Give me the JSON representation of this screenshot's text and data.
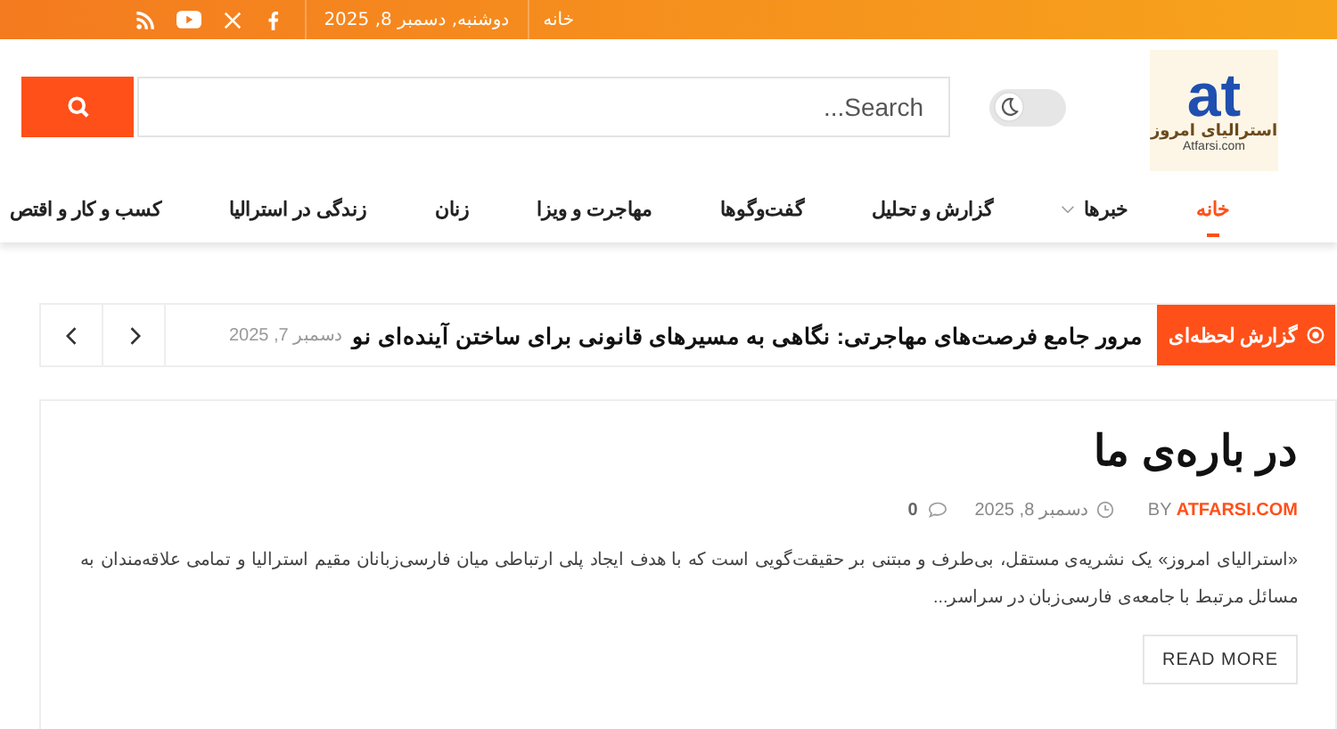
{
  "top_bar": {
    "links": [
      "خانه"
    ],
    "date": "دوشنبه, دسمبر 8, 2025",
    "social": [
      {
        "kind": "facebook"
      },
      {
        "kind": "x"
      },
      {
        "kind": "youtube"
      },
      {
        "kind": "rss"
      }
    ]
  },
  "header": {
    "logo": {
      "mark": "at",
      "name": "استرالیای امروز",
      "domain": "Atfarsi.com"
    },
    "dark_mode": {
      "on": false
    },
    "search": {
      "placeholder": "Search..."
    }
  },
  "nav": [
    {
      "label": "خانه",
      "selected": true,
      "dropdown": false
    },
    {
      "label": "خبرها",
      "selected": false,
      "dropdown": true
    },
    {
      "label": "گزارش و تحلیل",
      "selected": false,
      "dropdown": false
    },
    {
      "label": "گفت‌وگوها",
      "selected": false,
      "dropdown": false
    },
    {
      "label": "مهاجرت و ویزا",
      "selected": false,
      "dropdown": false
    },
    {
      "label": "زنان",
      "selected": false,
      "dropdown": false
    },
    {
      "label": "زندگی در استرالیا",
      "selected": false,
      "dropdown": false
    },
    {
      "label": "کسب و کار و اقتص",
      "selected": false,
      "dropdown": false
    }
  ],
  "ticker": {
    "label": "گزارش لحظه‌ای",
    "headline": "مرور جامع فرصت‌های مهاجرتی: نگاهی به مسیرهای قانونی برای ساختن آینده‌ای نو",
    "date": "دسمبر 7, 2025"
  },
  "post": {
    "title": "در باره‌ی ما",
    "by": "BY",
    "author": "ATFARSI.COM",
    "date": "دسمبر 8, 2025",
    "comments": "0",
    "excerpt": "«استرالیای امروز» یک نشریه‌ی مستقل، بی‌طرف و مبتنی بر حقیقت‌گویی است که با هدف ایجاد پلی ارتباطی میان فارسی‌زبانان مقیم استرالیا و تمامی علاقه‌مندان به مسائل مرتبط با جامعه‌ی فارسی‌زبان در سراسر...",
    "button": "READ MORE"
  }
}
